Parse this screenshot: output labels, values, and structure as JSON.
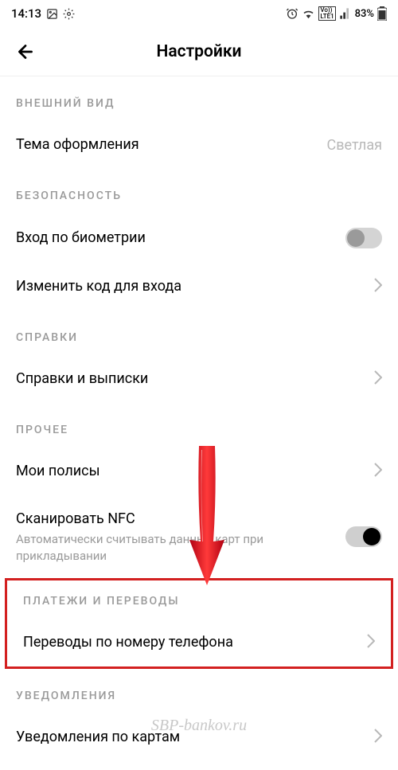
{
  "status": {
    "time": "14:13",
    "battery": "83%"
  },
  "header": {
    "title": "Настройки"
  },
  "sections": {
    "appearance": {
      "header": "ВНЕШНИЙ ВИД",
      "theme_label": "Тема оформления",
      "theme_value": "Светлая"
    },
    "security": {
      "header": "БЕЗОПАСНОСТЬ",
      "biometry_label": "Вход по биометрии",
      "change_code_label": "Изменить код для входа"
    },
    "references": {
      "header": "СПРАВКИ",
      "statements_label": "Справки и выписки"
    },
    "other": {
      "header": "ПРОЧЕЕ",
      "policies_label": "Мои полисы",
      "nfc_label": "Сканировать NFC",
      "nfc_subtitle": "Автоматически считывать данные карт при прикладывании"
    },
    "payments": {
      "header": "ПЛАТЕЖИ И ПЕРЕВОДЫ",
      "phone_transfer_label": "Переводы по номеру телефона"
    },
    "notifications": {
      "header": "УВЕДОМЛЕНИЯ",
      "cards_label": "Уведомления по картам"
    }
  },
  "watermark": "SBP-bankov.ru"
}
